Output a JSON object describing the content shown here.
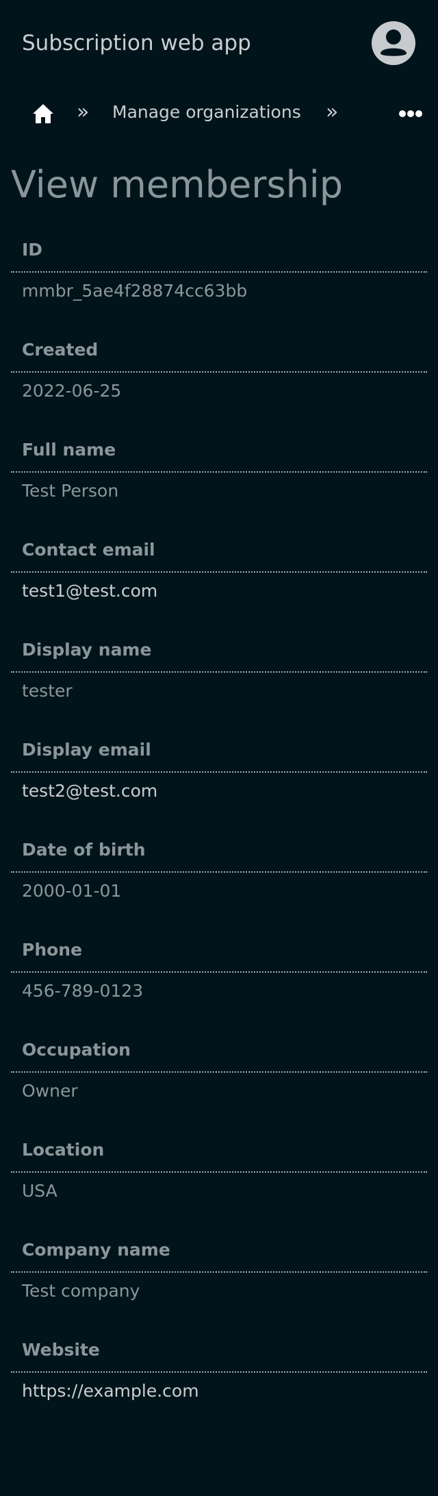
{
  "header": {
    "app_title": "Subscription web app"
  },
  "breadcrumb": {
    "separator": "»",
    "link": "Manage organizations"
  },
  "page_title": "View membership",
  "fields": [
    {
      "label": "ID",
      "value": "mmbr_5ae4f28874cc63bb"
    },
    {
      "label": "Created",
      "value": "2022-06-25"
    },
    {
      "label": "Full name",
      "value": "Test Person"
    },
    {
      "label": "Contact email",
      "value": "test1@test.com"
    },
    {
      "label": "Display name",
      "value": "tester"
    },
    {
      "label": "Display email",
      "value": "test2@test.com"
    },
    {
      "label": "Date of birth",
      "value": "2000-01-01"
    },
    {
      "label": "Phone",
      "value": "456-789-0123"
    },
    {
      "label": "Occupation",
      "value": "Owner"
    },
    {
      "label": "Location",
      "value": "USA"
    },
    {
      "label": "Company name",
      "value": "Test company"
    },
    {
      "label": "Website",
      "value": "https://example.com"
    }
  ],
  "colors": {
    "background": "#02141b",
    "text_primary": "#c9ced1",
    "text_muted": "#8b969b",
    "avatar_bg": "#c7cbcd",
    "icon_white": "#ffffff"
  },
  "icons": {
    "avatar": "user-avatar-icon",
    "home": "home-icon",
    "more": "more-horizontal-icon"
  }
}
